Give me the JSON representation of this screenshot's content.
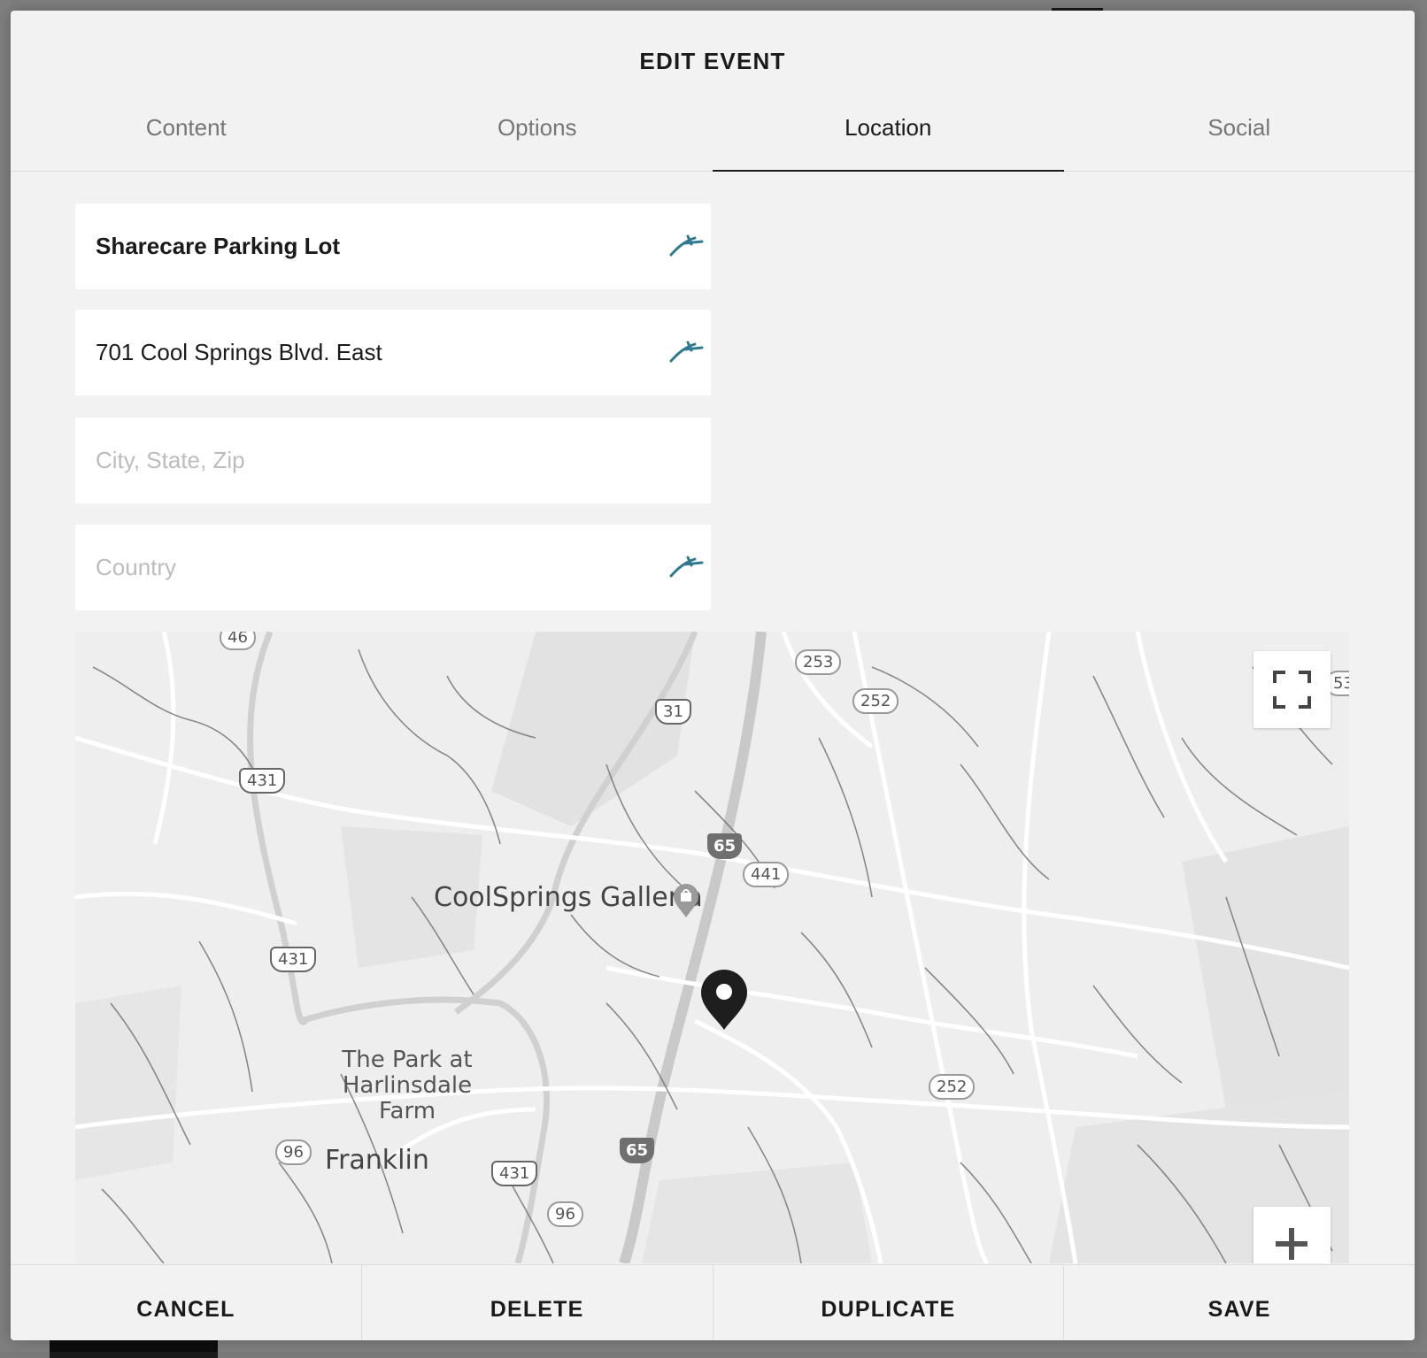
{
  "modal": {
    "title": "EDIT EVENT"
  },
  "tabs": [
    {
      "label": "Content"
    },
    {
      "label": "Options"
    },
    {
      "label": "Location"
    },
    {
      "label": "Social"
    }
  ],
  "location": {
    "name": {
      "value": "Sharecare Parking Lot",
      "placeholder": ""
    },
    "address": {
      "value": "701 Cool Springs Blvd. East",
      "placeholder": ""
    },
    "city_state_zip": {
      "value": "",
      "placeholder": "City, State, Zip"
    },
    "country": {
      "value": "",
      "placeholder": "Country"
    }
  },
  "map": {
    "labels": {
      "coolsprings": "CoolSprings Galleria",
      "park": "The Park at Harlinsdale Farm",
      "franklin": "Franklin"
    },
    "shields": {
      "r46": "46",
      "r253": "253",
      "r252a": "252",
      "r53": "53",
      "r31": "31",
      "r431a": "431",
      "i65a": "65",
      "r441": "441",
      "r431b": "431",
      "r252b": "252",
      "r96a": "96",
      "i65b": "65",
      "r431c": "431",
      "r96b": "96"
    }
  },
  "footer": {
    "cancel": "CANCEL",
    "delete": "DELETE",
    "duplicate": "DUPLICATE",
    "save": "SAVE"
  },
  "colors": {
    "accent_icon": "#2f7a90",
    "modal_bg": "#f2f2f2",
    "active_tab": "#1a1a1a",
    "inactive_tab": "#767676"
  },
  "icons": {
    "autofill": "autofill-swoosh-icon",
    "fullscreen": "fullscreen-icon",
    "zoom_in": "plus-icon",
    "marker": "map-pin-icon",
    "shopping": "shopping-bag-icon"
  }
}
